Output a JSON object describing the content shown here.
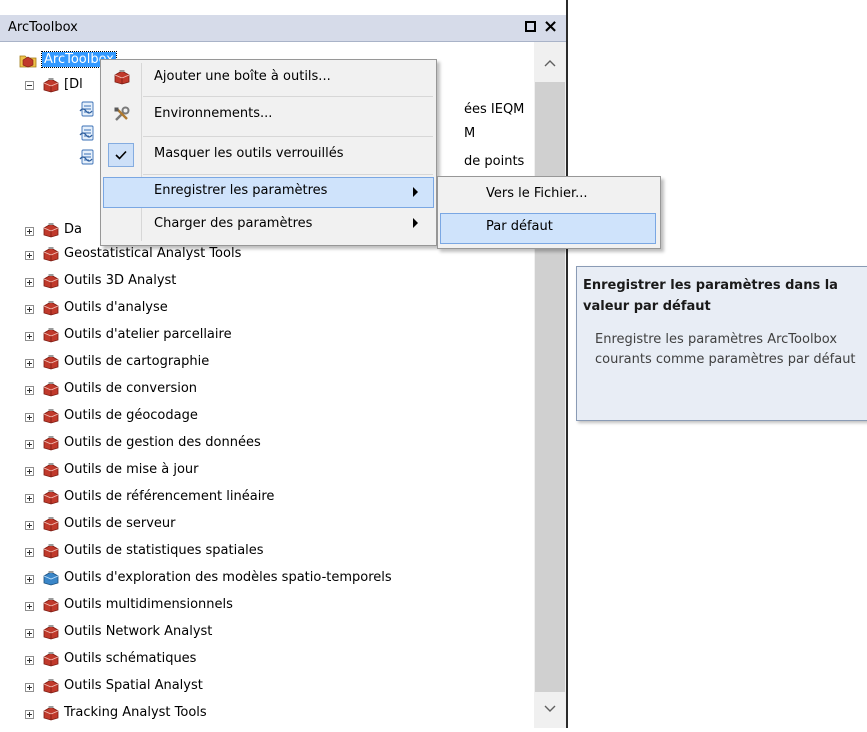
{
  "window": {
    "title": "ArcToolbox"
  },
  "tree": {
    "root_label": "ArcToolbox",
    "partial_rows": [
      {
        "label": "[Dl",
        "suffix": ""
      },
      {
        "label": "",
        "suffix": "ées IEQM"
      },
      {
        "label": "",
        "suffix": "M"
      },
      {
        "label": "",
        "suffix": "de points"
      },
      {
        "label": "Da",
        "suffix": ""
      }
    ],
    "items": [
      "Geostatistical Analyst Tools",
      "Outils 3D Analyst",
      "Outils d'analyse",
      "Outils d'atelier parcellaire",
      "Outils de cartographie",
      "Outils de conversion",
      "Outils de géocodage",
      "Outils de gestion des données",
      "Outils de mise à jour",
      "Outils de référencement linéaire",
      "Outils de serveur",
      "Outils de statistiques spatiales",
      "Outils d'exploration des modèles spatio-temporels",
      "Outils multidimensionnels",
      "Outils Network Analyst",
      "Outils schématiques",
      "Outils Spatial Analyst",
      "Tracking Analyst Tools"
    ]
  },
  "context_menu": {
    "items": [
      {
        "label": "Ajouter une boîte à outils...",
        "icon": "toolbox-icon"
      },
      {
        "label": "Environnements...",
        "icon": "tools-icon"
      },
      {
        "label": "Masquer les outils verrouillés",
        "icon": "checkmark-icon"
      },
      {
        "label": "Enregistrer les paramètres",
        "icon": ""
      },
      {
        "label": "Charger des paramètres",
        "icon": ""
      }
    ]
  },
  "submenu": {
    "items": [
      {
        "label": "Vers le Fichier..."
      },
      {
        "label": "Par défaut"
      }
    ]
  },
  "tooltip": {
    "title": "Enregistrer les paramètres dans la valeur par défaut",
    "body": "Enregistre les paramètres ArcToolbox courants comme paramètres par défaut"
  },
  "colors": {
    "title_bar": "#d6dbe9",
    "menu_bg": "#f1f1f1",
    "highlight": "#cfe3fb",
    "highlight_border": "#7aa7e3",
    "tooltip_bg": "#e8edf5",
    "toolbox_red": "#c0392b"
  }
}
